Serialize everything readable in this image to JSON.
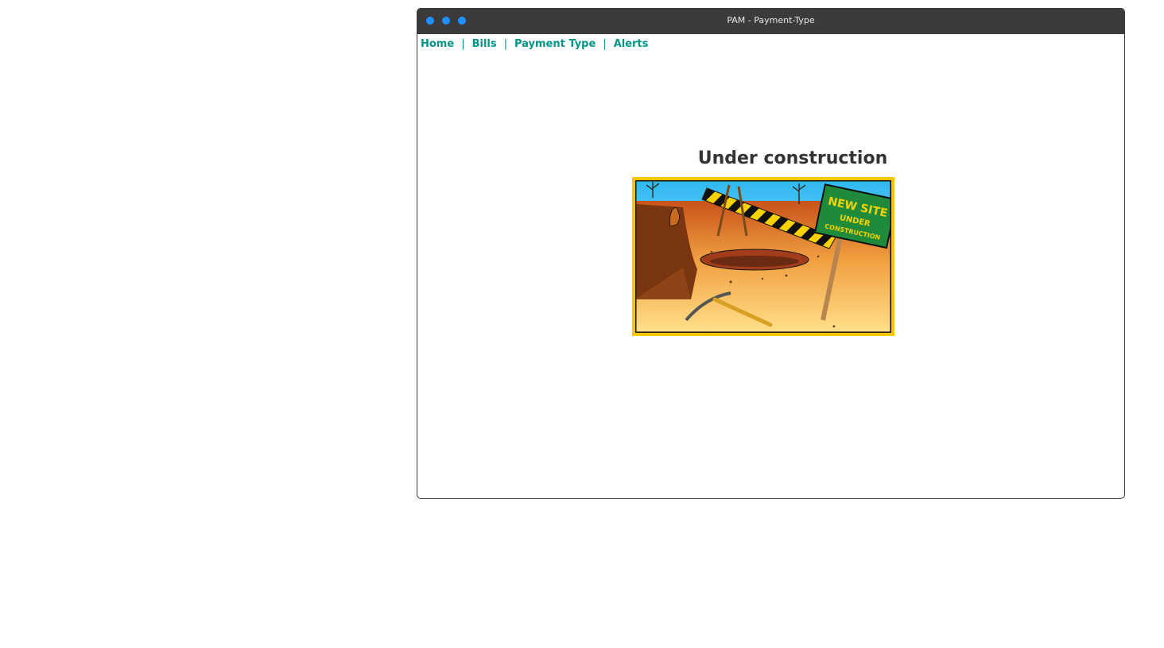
{
  "window": {
    "title": "PAM - Payment-Type"
  },
  "nav": {
    "items": [
      "Home",
      "Bills",
      "Payment Type",
      "Alerts"
    ],
    "separator": "|"
  },
  "main": {
    "heading": "Under construction",
    "sign_text": [
      "NEW SITE",
      "UNDER",
      "CONSTRUCTION"
    ]
  },
  "colors": {
    "accent": "#009688",
    "titlebar": "#3b3b3b",
    "window_dot": "#1e90ff",
    "frame": "#f7c600"
  }
}
